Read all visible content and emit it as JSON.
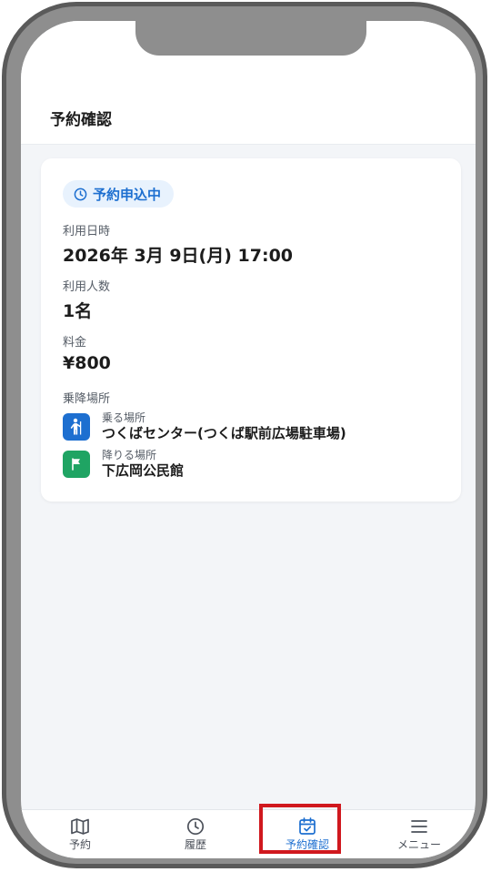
{
  "header": {
    "title": "予約確認"
  },
  "reservation": {
    "status": "予約申込中",
    "datetime_label": "利用日時",
    "datetime_value": "2026年 3月 9日(月) 17:00",
    "people_label": "利用人数",
    "people_value": "1名",
    "fare_label": "料金",
    "fare_value": "¥800",
    "stops_label": "乗降場所",
    "pickup": {
      "kind": "乗る場所",
      "name": "つくばセンター(つくば駅前広場駐車場)",
      "icon": "person-standing-icon",
      "color": "#1d6fd0"
    },
    "dropoff": {
      "kind": "降りる場所",
      "name": "下広岡公民館",
      "icon": "flag-icon",
      "color": "#1fa463"
    }
  },
  "bottom_nav": {
    "items": [
      {
        "label": "予約",
        "icon": "map-icon"
      },
      {
        "label": "履歴",
        "icon": "clock-icon"
      },
      {
        "label": "予約確認",
        "icon": "calendar-check-icon",
        "active": true
      },
      {
        "label": "メニュー",
        "icon": "menu-icon"
      }
    ]
  },
  "colors": {
    "accent": "#1d6fd0",
    "highlight": "#d0181e",
    "frame": "#8e8e8e"
  }
}
